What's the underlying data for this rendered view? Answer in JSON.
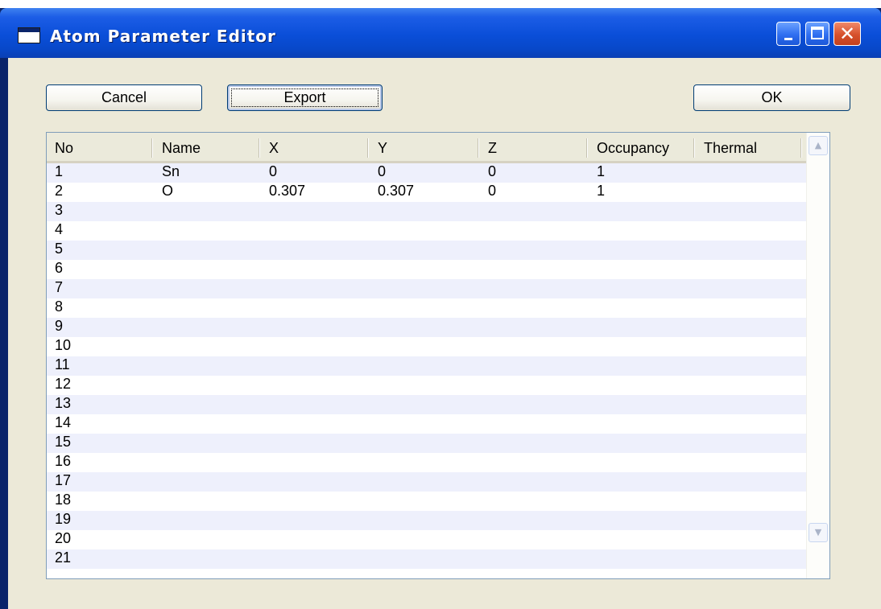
{
  "window": {
    "title": "Atom Parameter Editor",
    "close_glyph": "✕"
  },
  "buttons": {
    "cancel": "Cancel",
    "export": "Export",
    "ok": "OK"
  },
  "table": {
    "columns": [
      "No",
      "Name",
      "X",
      "Y",
      "Z",
      "Occupancy",
      "Thermal"
    ],
    "rows": [
      {
        "no": "1",
        "name": "Sn",
        "x": "0",
        "y": "0",
        "z": "0",
        "occupancy": "1",
        "thermal": ""
      },
      {
        "no": "2",
        "name": "O",
        "x": "0.307",
        "y": "0.307",
        "z": "0",
        "occupancy": "1",
        "thermal": ""
      },
      {
        "no": "3",
        "name": "",
        "x": "",
        "y": "",
        "z": "",
        "occupancy": "",
        "thermal": ""
      },
      {
        "no": "4",
        "name": "",
        "x": "",
        "y": "",
        "z": "",
        "occupancy": "",
        "thermal": ""
      },
      {
        "no": "5",
        "name": "",
        "x": "",
        "y": "",
        "z": "",
        "occupancy": "",
        "thermal": ""
      },
      {
        "no": "6",
        "name": "",
        "x": "",
        "y": "",
        "z": "",
        "occupancy": "",
        "thermal": ""
      },
      {
        "no": "7",
        "name": "",
        "x": "",
        "y": "",
        "z": "",
        "occupancy": "",
        "thermal": ""
      },
      {
        "no": "8",
        "name": "",
        "x": "",
        "y": "",
        "z": "",
        "occupancy": "",
        "thermal": ""
      },
      {
        "no": "9",
        "name": "",
        "x": "",
        "y": "",
        "z": "",
        "occupancy": "",
        "thermal": ""
      },
      {
        "no": "10",
        "name": "",
        "x": "",
        "y": "",
        "z": "",
        "occupancy": "",
        "thermal": ""
      },
      {
        "no": "11",
        "name": "",
        "x": "",
        "y": "",
        "z": "",
        "occupancy": "",
        "thermal": ""
      },
      {
        "no": "12",
        "name": "",
        "x": "",
        "y": "",
        "z": "",
        "occupancy": "",
        "thermal": ""
      },
      {
        "no": "13",
        "name": "",
        "x": "",
        "y": "",
        "z": "",
        "occupancy": "",
        "thermal": ""
      },
      {
        "no": "14",
        "name": "",
        "x": "",
        "y": "",
        "z": "",
        "occupancy": "",
        "thermal": ""
      },
      {
        "no": "15",
        "name": "",
        "x": "",
        "y": "",
        "z": "",
        "occupancy": "",
        "thermal": ""
      },
      {
        "no": "16",
        "name": "",
        "x": "",
        "y": "",
        "z": "",
        "occupancy": "",
        "thermal": ""
      },
      {
        "no": "17",
        "name": "",
        "x": "",
        "y": "",
        "z": "",
        "occupancy": "",
        "thermal": ""
      },
      {
        "no": "18",
        "name": "",
        "x": "",
        "y": "",
        "z": "",
        "occupancy": "",
        "thermal": ""
      },
      {
        "no": "19",
        "name": "",
        "x": "",
        "y": "",
        "z": "",
        "occupancy": "",
        "thermal": ""
      },
      {
        "no": "20",
        "name": "",
        "x": "",
        "y": "",
        "z": "",
        "occupancy": "",
        "thermal": ""
      },
      {
        "no": "21",
        "name": "",
        "x": "",
        "y": "",
        "z": "",
        "occupancy": "",
        "thermal": ""
      }
    ]
  },
  "scrollbar": {
    "up_glyph": "▲",
    "down_glyph": "▼"
  }
}
